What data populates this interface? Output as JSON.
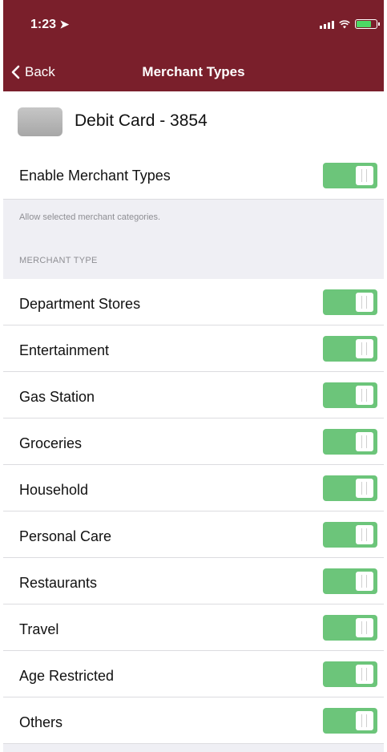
{
  "status_bar": {
    "time": "1:23"
  },
  "nav": {
    "back_label": "Back",
    "title": "Merchant Types"
  },
  "card": {
    "name": "Debit Card - 3854"
  },
  "enable": {
    "label": "Enable Merchant Types",
    "on": true
  },
  "help_text": "Allow selected merchant categories.",
  "section_header": "MERCHANT TYPE",
  "merchant_types": [
    {
      "label": "Department Stores",
      "on": true
    },
    {
      "label": "Entertainment",
      "on": true
    },
    {
      "label": "Gas Station",
      "on": true
    },
    {
      "label": "Groceries",
      "on": true
    },
    {
      "label": "Household",
      "on": true
    },
    {
      "label": "Personal Care",
      "on": true
    },
    {
      "label": "Restaurants",
      "on": true
    },
    {
      "label": "Travel",
      "on": true
    },
    {
      "label": "Age Restricted",
      "on": true
    },
    {
      "label": "Others",
      "on": true
    }
  ],
  "colors": {
    "nav_bg": "#7a1f2b",
    "toggle_on": "#6cc57a",
    "page_bg": "#efeff4"
  },
  "icons": [
    "location-arrow-icon",
    "signal-icon",
    "wifi-icon",
    "battery-charging-icon",
    "chevron-left-icon",
    "card-icon"
  ]
}
